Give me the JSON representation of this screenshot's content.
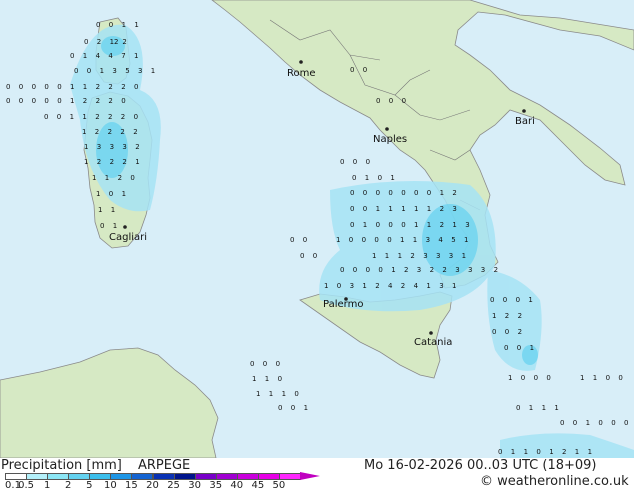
{
  "cities": [
    {
      "name": "Rome"
    },
    {
      "name": "Bari"
    },
    {
      "name": "Naples"
    },
    {
      "name": "Cagliari"
    },
    {
      "name": "Palermo"
    },
    {
      "name": "Catania"
    }
  ],
  "footer": {
    "title": "Precipitation [mm]",
    "model": "ARPEGE",
    "datetime": "Mo 16-02-2026 00..03 UTC (18+09)",
    "site": "© weatheronline.co.uk"
  },
  "legend": {
    "ticks": [
      "0.1",
      "0.5",
      "1",
      "2",
      "5",
      "10",
      "15",
      "20",
      "25",
      "30",
      "35",
      "40",
      "45",
      "50"
    ],
    "colors": [
      "#ffffff",
      "#b4f0fa",
      "#8ce6f5",
      "#64d2f0",
      "#3cbeeb",
      "#1e96e6",
      "#1464d2",
      "#0a32b4",
      "#00148c",
      "#7800c8",
      "#a000d2",
      "#c800dc",
      "#e600e6",
      "#ff28ff"
    ]
  },
  "colors": {
    "sea": "#d8eef8",
    "land": "#d6e9c4",
    "rain": "#a6e3f5"
  }
}
